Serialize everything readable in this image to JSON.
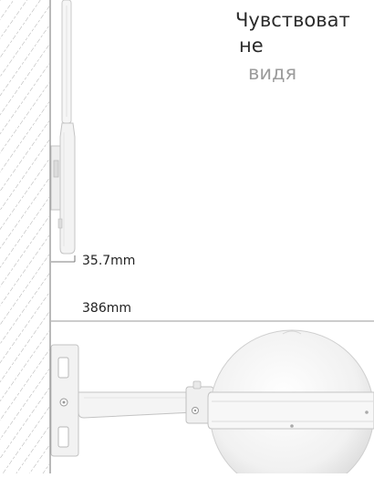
{
  "headline": {
    "line1": "Чувствоват",
    "line2": "не",
    "line3": "видя"
  },
  "dimensions": {
    "depth_label": "35.7mm",
    "width_label": "386mm"
  },
  "colors": {
    "wall_line": "#8a8a8a",
    "device_fill": "#f4f4f4",
    "device_stroke": "#c8c8c8",
    "text_dark": "#2b2b2b",
    "text_muted": "#9c9c9c"
  }
}
